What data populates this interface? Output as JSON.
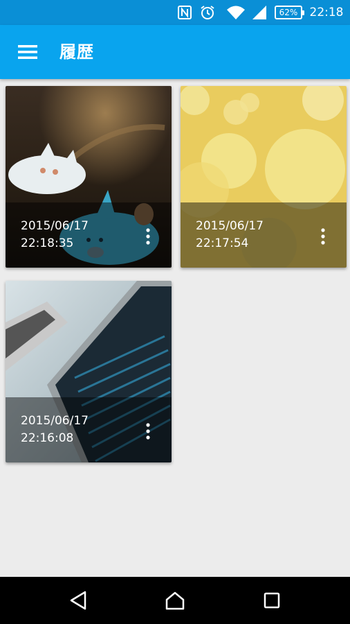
{
  "status_bar": {
    "nfc_icon": "nfc-icon",
    "alarm_icon": "alarm-icon",
    "wifi_icon": "wifi-icon",
    "signal_icon": "signal-icon",
    "battery_level": "62%",
    "time": "22:18",
    "background": "#0a8fd6"
  },
  "app_bar": {
    "title": "履歴",
    "menu_icon": "hamburger-menu-icon",
    "background": "#09a4ee"
  },
  "history": {
    "items": [
      {
        "date": "2015/06/17",
        "time": "22:18:35",
        "thumbnail": "cartoon-cat-creatures-photo",
        "more_icon": "more-vert-icon"
      },
      {
        "date": "2015/06/17",
        "time": "22:17:54",
        "thumbnail": "yellow-bokeh-photo",
        "more_icon": "more-vert-icon"
      },
      {
        "date": "2015/06/17",
        "time": "22:16:08",
        "thumbnail": "laptop-screen-photo",
        "more_icon": "more-vert-icon"
      }
    ]
  },
  "nav_bar": {
    "back_icon": "back-triangle-icon",
    "home_icon": "home-icon",
    "recents_icon": "recents-square-icon"
  }
}
